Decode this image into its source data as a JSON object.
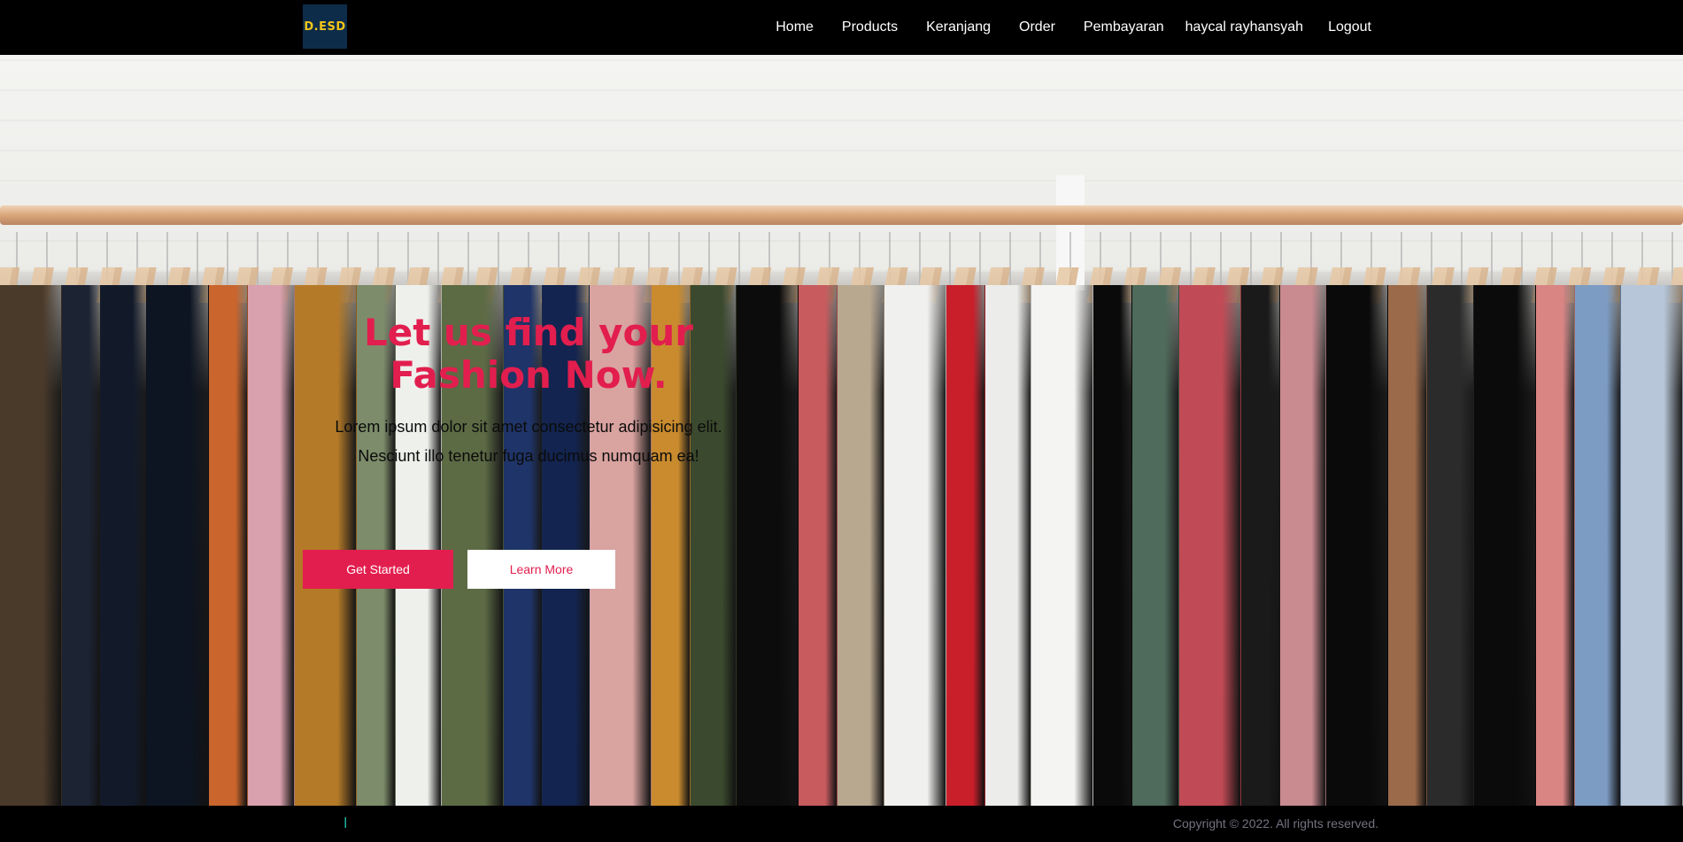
{
  "navbar": {
    "logo_text": "D.ESD",
    "links": [
      "Home",
      "Products",
      "Keranjang",
      "Order",
      "Pembayaran",
      "haycal rayhansyah",
      "Logout"
    ]
  },
  "hero": {
    "title_line1": "Let us find your",
    "title_line2": "Fashion Now.",
    "text_line1": "Lorem ipsum dolor sit amet consectetur adipisicing elit.",
    "text_line2": "Nesciunt illo tenetur fuga ducimus numquam ea!",
    "primary_button": "Get Started",
    "secondary_button": "Learn More",
    "accent_color": "#e21e4e"
  },
  "clothes_colors": [
    "#4a3a2a",
    "#1c2333",
    "#121a2a",
    "#0d1422",
    "#c9652d",
    "#d9a0ad",
    "#b57a28",
    "#7d8c6a",
    "#eef0ec",
    "#5d6b45",
    "#1f3468",
    "#12244f",
    "#d9a3a0",
    "#c98b2e",
    "#3b4a2e",
    "#0c0c0c",
    "#c75b5e",
    "#b9a890",
    "#f0f0ee",
    "#c81f2a",
    "#ececea",
    "#f4f4f2",
    "#0a0a0a",
    "#4e6b5c",
    "#c04a55",
    "#1a1a1a",
    "#c98a90",
    "#0a0a0a",
    "#9a6a4a",
    "#2b2b2b",
    "#0b0b0b",
    "#d98584",
    "#7d9cc4",
    "#b7c6d8"
  ],
  "footer": {
    "mark": "l",
    "copyright": "Copyright © 2022. All rights reserved."
  }
}
